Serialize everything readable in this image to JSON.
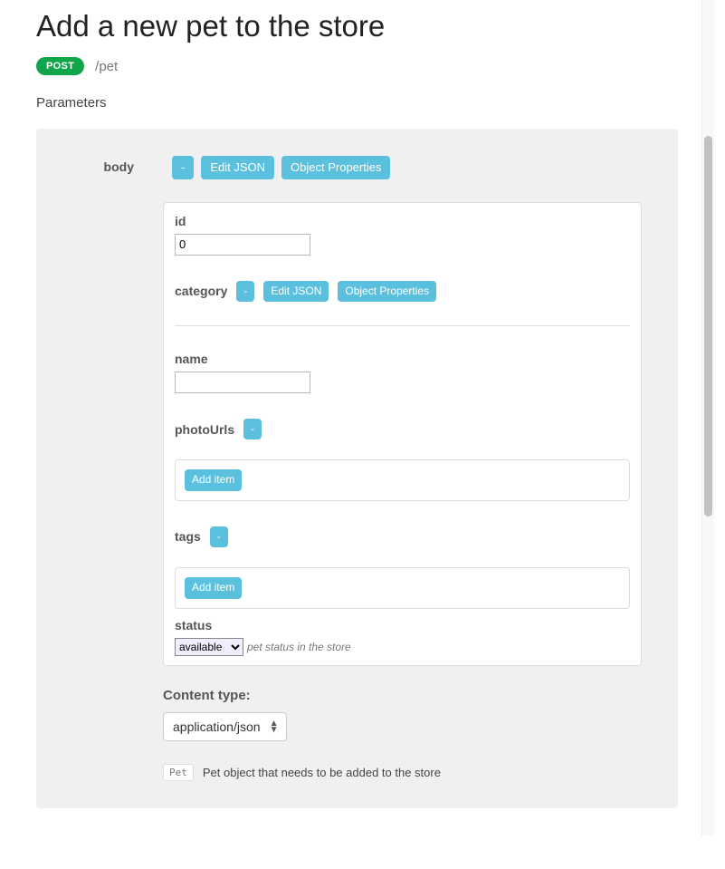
{
  "header": {
    "title": "Add a new pet to the store",
    "method": "POST",
    "path": "/pet"
  },
  "sections": {
    "parameters_title": "Parameters"
  },
  "body": {
    "label": "body",
    "buttons": {
      "collapse": "-",
      "edit_json": "Edit JSON",
      "object_props": "Object Properties"
    },
    "fields": {
      "id": {
        "label": "id",
        "value": "0"
      },
      "category": {
        "label": "category",
        "collapse": "-",
        "edit_json": "Edit JSON",
        "object_props": "Object Properties"
      },
      "name": {
        "label": "name",
        "value": ""
      },
      "photoUrls": {
        "label": "photoUrls",
        "collapse": "-",
        "add_item": "Add item"
      },
      "tags": {
        "label": "tags",
        "collapse": "-",
        "add_item": "Add item"
      },
      "status": {
        "label": "status",
        "value": "available",
        "description": "pet status in the store"
      }
    },
    "content_type": {
      "label": "Content type:",
      "value": "application/json"
    },
    "model": {
      "name": "Pet",
      "description": "Pet object that needs to be added to the store"
    }
  }
}
